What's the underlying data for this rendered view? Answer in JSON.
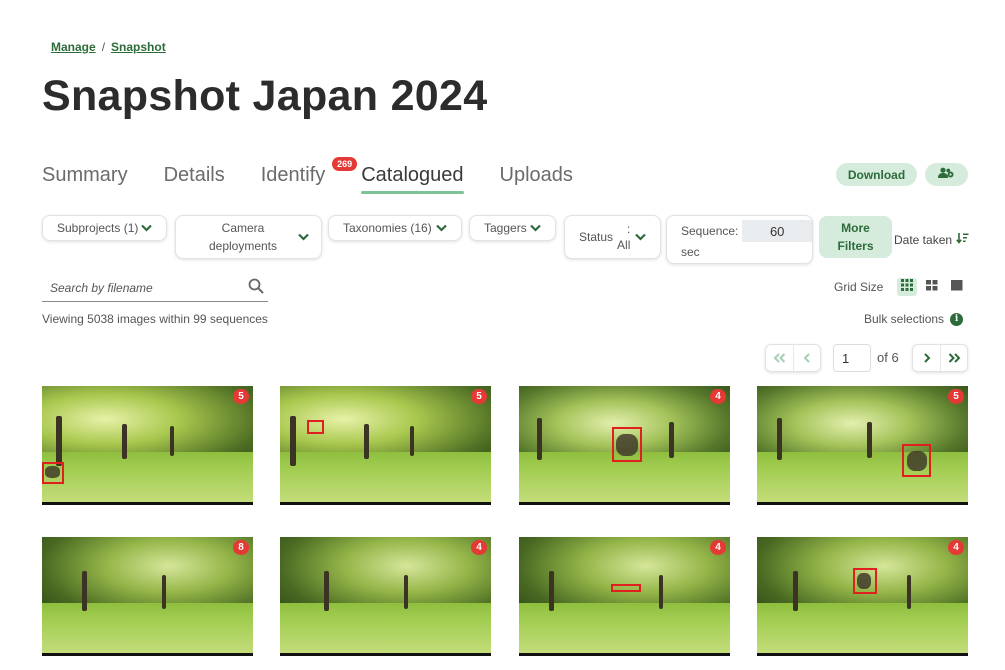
{
  "breadcrumb": {
    "items": [
      "Manage",
      "Snapshot"
    ],
    "separator": "/"
  },
  "page_title": "Snapshot Japan 2024",
  "tabs": [
    {
      "label": "Summary",
      "active": false
    },
    {
      "label": "Details",
      "active": false
    },
    {
      "label": "Identify",
      "active": false,
      "badge": "269"
    },
    {
      "label": "Catalogued",
      "active": true
    },
    {
      "label": "Uploads",
      "active": false
    }
  ],
  "actions": {
    "download_label": "Download",
    "users_icon": "users-cog-icon"
  },
  "filters": {
    "subprojects": "Subprojects (1)",
    "camera_line1": "Camera",
    "camera_line2": "deployments",
    "taxonomies": "Taxonomies (16)",
    "taggers": "Taggers",
    "status_label": "Status",
    "status_colon": ":",
    "status_value": "All",
    "sequence_label": "Sequence:",
    "sequence_value": "60",
    "sequence_unit": "sec",
    "more_line1": "More",
    "more_line2": "Filters",
    "date_taken": "Date taken"
  },
  "search": {
    "placeholder": "Search by filename"
  },
  "grid": {
    "label": "Grid Size",
    "selected": "small"
  },
  "summary": {
    "viewing": "Viewing 5038 images within 99 sequences",
    "bulk": "Bulk selections"
  },
  "pagination": {
    "current_page": "1",
    "of_label": "of 6"
  },
  "images": [
    {
      "count": "5"
    },
    {
      "count": "5"
    },
    {
      "count": "4"
    },
    {
      "count": "5"
    },
    {
      "count": "8"
    },
    {
      "count": "4"
    },
    {
      "count": "4"
    },
    {
      "count": "4"
    }
  ],
  "colors": {
    "accent": "#2e6b3a",
    "accent_light": "#d5ecdc",
    "badge": "#e53935",
    "tab_underline": "#7cc495"
  }
}
